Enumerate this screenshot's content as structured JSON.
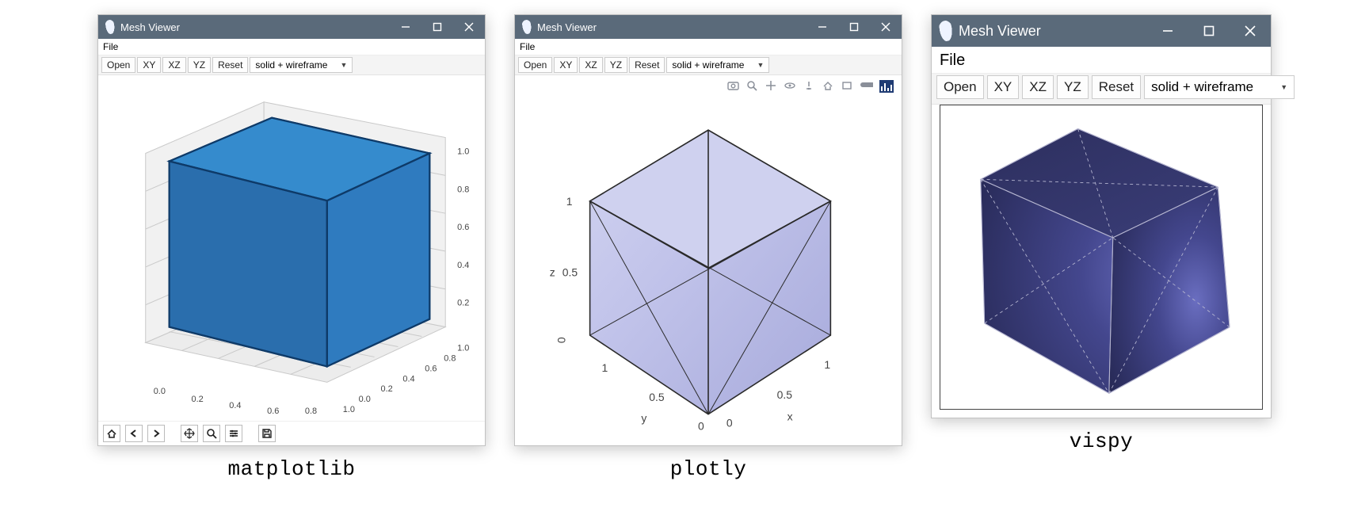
{
  "common": {
    "window_title": "Mesh Viewer",
    "menu_file": "File",
    "btn_open": "Open",
    "btn_xy": "XY",
    "btn_xz": "XZ",
    "btn_yz": "YZ",
    "btn_reset": "Reset",
    "select_mode": "solid + wireframe"
  },
  "captions": {
    "mpl": "matplotlib",
    "plotly": "plotly",
    "vispy": "vispy"
  },
  "mpl": {
    "tool_icons": [
      "home-icon",
      "back-icon",
      "forward-icon",
      "pan-icon",
      "zoom-icon",
      "subplots-icon",
      "save-icon"
    ],
    "axis_ticks_x": [
      "0.0",
      "0.2",
      "0.4",
      "0.6",
      "0.8",
      "1.0"
    ],
    "axis_ticks_y": [
      "0.0",
      "0.2",
      "0.4",
      "0.6",
      "0.8",
      "1.0"
    ],
    "axis_ticks_z": [
      "0.2",
      "0.4",
      "0.6",
      "0.8",
      "1.0"
    ],
    "cube_color": "#2f7bbf",
    "cube_edge": "#0e3a68"
  },
  "plotly": {
    "axis_labels": {
      "x": "x",
      "y": "y",
      "z": "z"
    },
    "axis_ticks": [
      "0",
      "0.5",
      "1"
    ],
    "tool_icons": [
      "camera-icon",
      "zoom-icon",
      "pan-icon",
      "orbit-icon",
      "turntable-icon",
      "home-icon",
      "last-icon",
      "toggle-icon",
      "plotly-logo-icon"
    ],
    "cube_fill": "#c1c3ea",
    "cube_edge": "#2a2a2a"
  },
  "vispy": {
    "cube_fill_dark": "#282a58",
    "cube_fill_light": "#5a5fb0",
    "cube_edge": "#b5b5d0"
  }
}
